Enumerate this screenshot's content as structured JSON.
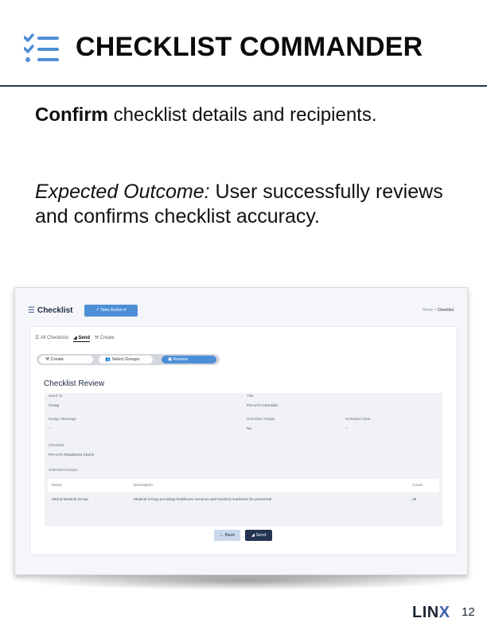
{
  "slide": {
    "title": "CHECKLIST COMMANDER",
    "confirm_bold": "Confirm",
    "confirm_rest": " checklist details and recipients.",
    "outcome_label": "Expected Outcome:",
    "outcome_text": " User successfully reviews and confirms checklist accuracy.",
    "footer_logo_a": "LIN",
    "footer_logo_b": "X",
    "page_number": "12"
  },
  "app": {
    "title_icon": "list-icon",
    "title": "Checklist",
    "take_action_label": "⚡ Take Action ▾",
    "breadcrumb_home": "Home",
    "breadcrumb_sep": " > ",
    "breadcrumb_current": "Checklist",
    "tabs": [
      {
        "label": "☰ All Checklists",
        "active": false
      },
      {
        "label": "◢ Send",
        "active": true
      },
      {
        "label": "⚒ Create",
        "active": false
      }
    ],
    "steps": [
      {
        "label": "⚒ Create",
        "active": false
      },
      {
        "label": "👥 Select Groups",
        "active": false
      },
      {
        "label": "▣ Review",
        "active": true
      }
    ],
    "review_title": "Checklist Review",
    "fields": {
      "send_to_label": "Send To",
      "send_to_value": "Group",
      "title_label": "Title",
      "title_value": "Pre-UTA Checklist",
      "nudge_message_label": "Nudge Message",
      "nudge_message_value": "--",
      "schedule_nudge_label": "Schedule Nudge",
      "schedule_nudge_value": "No",
      "schedule_date_label": "Schedule Date",
      "schedule_date_value": "--",
      "checklist_label": "Checklist",
      "checklist_value": "Pre-UTA Readiness Check",
      "selected_groups_label": "Selected Groups:"
    },
    "groups_table": {
      "headers": [
        "Name",
        "Description",
        "Count"
      ],
      "rows": [
        [
          "932nd Medical Group",
          "Medical Group providing healthcare services and medical readiness for personnel",
          "28"
        ]
      ]
    },
    "back_label": "← Back",
    "send_label": "◢ Send"
  },
  "colors": {
    "primary": "#4d8fd6",
    "navy": "#243452",
    "header_rule": "#26354d"
  }
}
